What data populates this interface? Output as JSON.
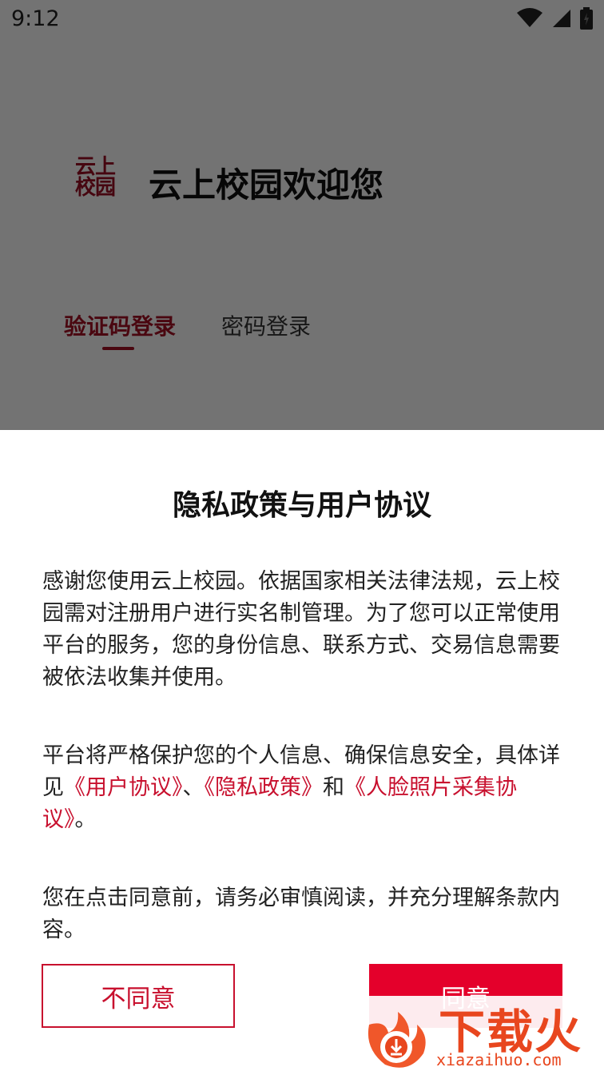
{
  "status_bar": {
    "time": "9:12"
  },
  "login_page": {
    "logo_text": "云上校园",
    "welcome": "云上校园欢迎您",
    "tabs": [
      {
        "label": "验证码登录",
        "active": true
      },
      {
        "label": "密码登录",
        "active": false
      }
    ]
  },
  "dialog": {
    "title": "隐私政策与用户协议",
    "para1": "感谢您使用云上校园。依据国家相关法律法规，云上校园需对注册用户进行实名制管理。为了您可以正常使用平台的服务，您的身份信息、联系方式、交易信息需要被依法收集并使用。",
    "para2_prefix": "平台将严格保护您的个人信息、确保信息安全，具体详见",
    "link_user": "《用户协议》",
    "sep1": "、",
    "link_privacy": "《隐私政策》",
    "and": "和",
    "link_face": "《人脸照片采集协议》",
    "para2_suffix": "。",
    "para3": "您在点击同意前，请务必审慎阅读，并充分理解条款内容。",
    "disagree_label": "不同意",
    "agree_label": "同意"
  },
  "watermark": {
    "brand": "下载火",
    "url": "xiazaihuo.com"
  },
  "colors": {
    "accent": "#c8102e",
    "agree_button": "#e4002b",
    "watermark": "#e8461e"
  }
}
